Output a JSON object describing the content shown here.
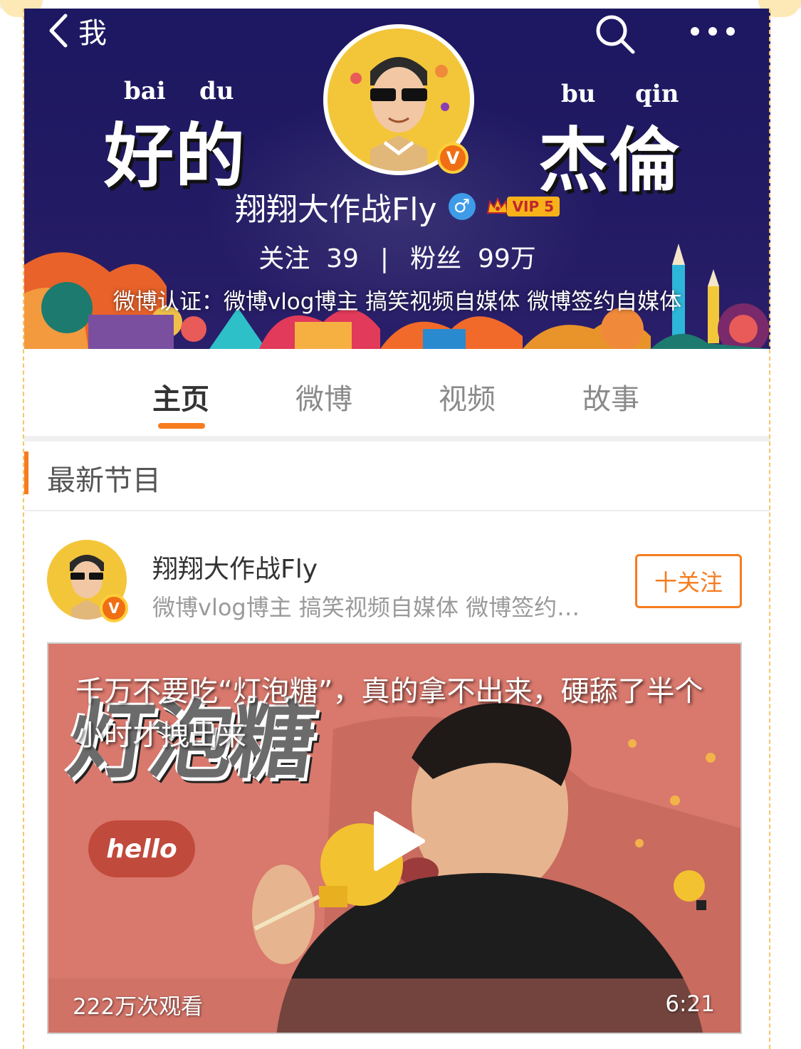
{
  "header": {
    "back_label": "我",
    "pinyin_left_1": "bai",
    "pinyin_left_2": "du",
    "chars_left": "好的",
    "pinyin_right_1": "bu",
    "pinyin_right_2": "qin",
    "chars_right": "杰倫",
    "verified_mark": "V",
    "nickname": "翔翔大作战Fly",
    "gender_symbol": "♂",
    "vip_label": "VIP 5",
    "following_label": "关注",
    "following_count": "39",
    "stats_separator": "|",
    "fans_label": "粉丝",
    "fans_count": "99万",
    "certification": "微博认证：微博vlog博主 搞笑视频自媒体 微博签约自媒体"
  },
  "tabs": [
    {
      "label": "主页",
      "active": true
    },
    {
      "label": "微博",
      "active": false
    },
    {
      "label": "视频",
      "active": false
    },
    {
      "label": "故事",
      "active": false
    }
  ],
  "section": {
    "title": "最新节目"
  },
  "card": {
    "name": "翔翔大作战Fly",
    "description": "微博vlog博主 搞笑视频自媒体 微博签约…",
    "verified_mark": "V",
    "follow_label": "十关注"
  },
  "video": {
    "title": "千万不要吃“灯泡糖”，真的拿不出来，硬舔了半个小时才拽出来",
    "overlay_text": "灯泡糖",
    "sticker_text": "hello",
    "views": "222万次观看",
    "duration": "6:21"
  },
  "colors": {
    "accent": "#f67c1f",
    "header_bg": "#1d1862",
    "video_bg": "#d9786c"
  }
}
